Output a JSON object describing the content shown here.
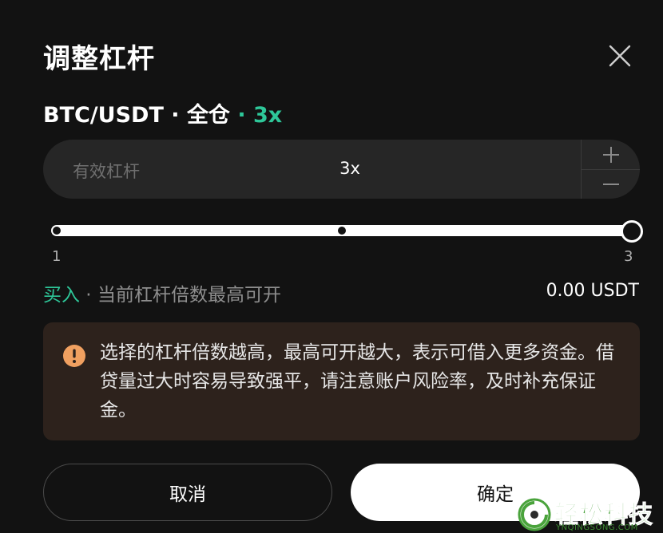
{
  "modal": {
    "title": "调整杠杆"
  },
  "pair": {
    "symbol": "BTC/USDT",
    "separator1": " · ",
    "margin_mode": "全仓",
    "separator2": " · ",
    "leverage": "3x"
  },
  "leverage_input": {
    "label": "有效杠杆",
    "value": "3x",
    "plus_icon": "plus-icon",
    "minus_icon": "minus-icon"
  },
  "slider": {
    "min_label": "1",
    "max_label": "3",
    "min": 1,
    "max": 3,
    "value": 3
  },
  "max_open": {
    "side": "买入",
    "separator": " · ",
    "label": "当前杠杆倍数最高可开",
    "value": "0.00 USDT"
  },
  "warning": {
    "icon": "exclamation-icon",
    "text": "选择的杠杆倍数越高，最高可开越大，表示可借入更多资金。借贷量过大时容易导致强平，请注意账户风险率，及时补充保证金。"
  },
  "buttons": {
    "cancel": "取消",
    "confirm": "确定"
  },
  "watermark": {
    "text": "轻松科技",
    "sub": "YNQINGSONG.COM"
  },
  "colors": {
    "background": "#121212",
    "accent_green": "#2ec799",
    "warning_bg": "#2d221c",
    "warning_icon": "#f0a060"
  }
}
